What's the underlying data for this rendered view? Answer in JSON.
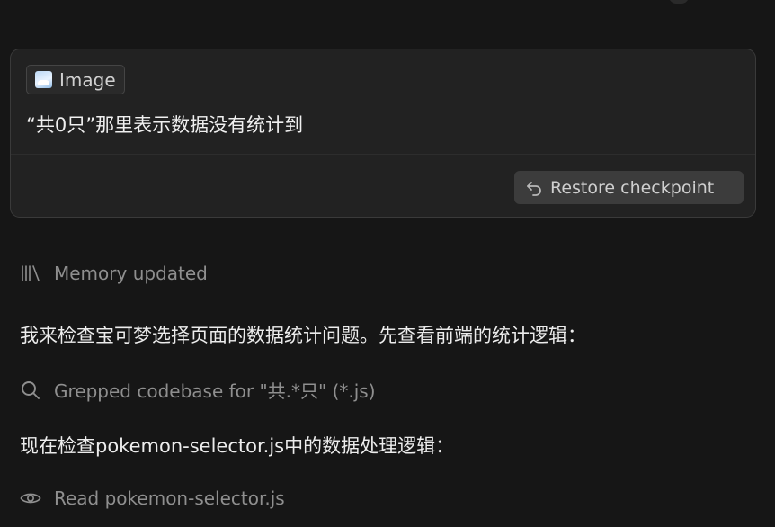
{
  "message": {
    "attachment_label": "Image",
    "attachment_icon": "image-icon",
    "text": "“共0只”那里表示数据没有统计到",
    "restore_label": "Restore checkpoint",
    "restore_icon": "undo-arrow-icon"
  },
  "feed": {
    "memory": {
      "icon": "library-icon",
      "label": "Memory updated"
    },
    "intro_text": "我来检查宝可梦选择页面的数据统计问题。先查看前端的统计逻辑：",
    "grep": {
      "icon": "search-icon",
      "label": "Grepped codebase for \"共.*只\" (*.js)"
    },
    "next_text": "现在检查pokemon-selector.js中的数据处理逻辑：",
    "read": {
      "icon": "eye-icon",
      "label": "Read pokemon-selector.js"
    }
  },
  "colors": {
    "background": "#161616",
    "card": "#222222",
    "button": "#3c3c3c",
    "muted_text": "#8f8f8f",
    "text": "#ececec"
  }
}
